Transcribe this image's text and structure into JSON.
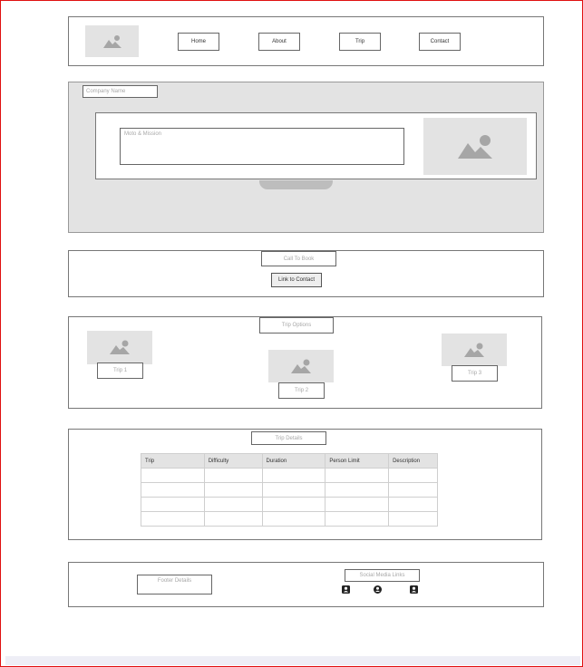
{
  "header": {
    "nav": [
      {
        "label": "Home"
      },
      {
        "label": "About"
      },
      {
        "label": "Trip"
      },
      {
        "label": "Contact"
      }
    ]
  },
  "hero": {
    "company_name_placeholder": "Company Name",
    "moto_placeholder": "Moto & Mission"
  },
  "cta": {
    "title": "Call To Book",
    "button": "Link to Contact"
  },
  "trips": {
    "title": "Trip Options",
    "items": [
      {
        "label": "Trip 1"
      },
      {
        "label": "Trip 2"
      },
      {
        "label": "Trip 3"
      }
    ]
  },
  "details": {
    "title": "Trip Details",
    "columns": [
      "Trip",
      "Difficulty",
      "Duration",
      "Person Limit",
      "Description"
    ],
    "rows": [
      [
        "",
        "",
        "",
        "",
        ""
      ],
      [
        "",
        "",
        "",
        "",
        ""
      ],
      [
        "",
        "",
        "",
        "",
        ""
      ],
      [
        "",
        "",
        "",
        "",
        ""
      ]
    ]
  },
  "footer": {
    "details": "Footer Details",
    "social_title": "Social Media Links",
    "social_icons": [
      "person-icon",
      "globe-icon",
      "person-icon"
    ]
  },
  "colors": {
    "frame": "#e01010",
    "placeholder_bg": "#e3e3e3",
    "image_glyph": "#a6a6a6"
  }
}
